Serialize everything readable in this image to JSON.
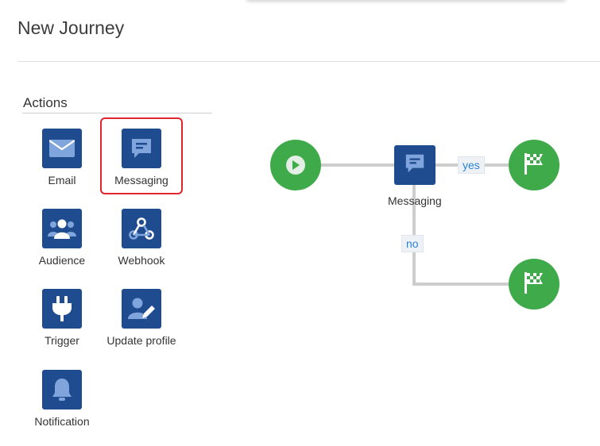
{
  "page": {
    "title": "New Journey"
  },
  "actions": {
    "heading": "Actions",
    "items": [
      {
        "label": "Email",
        "icon": "email-icon"
      },
      {
        "label": "Messaging",
        "icon": "message-icon"
      },
      {
        "label": "Audience",
        "icon": "audience-icon"
      },
      {
        "label": "Webhook",
        "icon": "webhook-icon"
      },
      {
        "label": "Trigger",
        "icon": "plug-icon"
      },
      {
        "label": "Update profile",
        "icon": "user-edit-icon"
      },
      {
        "label": "Notification",
        "icon": "bell-icon"
      }
    ],
    "selected": "Messaging"
  },
  "journey": {
    "nodes": {
      "start": {
        "icon": "play-icon"
      },
      "messaging": {
        "label": "Messaging",
        "icon": "message-icon"
      },
      "end_yes": {
        "icon": "finish-flag-icon"
      },
      "end_no": {
        "icon": "finish-flag-icon"
      }
    },
    "edges": {
      "yes_label": "yes",
      "no_label": "no"
    }
  },
  "colors": {
    "tile": "#1f4c8f",
    "node_green": "#3eaa4a",
    "selection": "#e0252d",
    "edge_text": "#2b82d9",
    "connector": "#cdcdcd"
  }
}
